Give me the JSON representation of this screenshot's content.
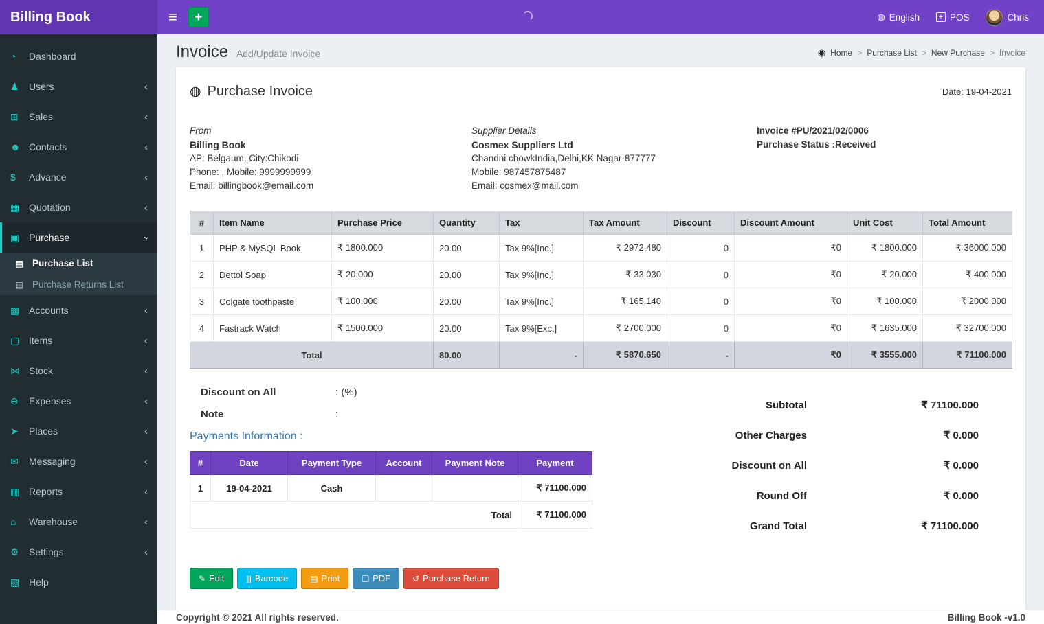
{
  "colors": {
    "navbar_purple": "#7142c8",
    "brand_purple": "#6236b2",
    "sidebar_dark": "#222d32",
    "sidebar_icon_teal": "#26c6c0",
    "table_header_gray": "#d7dbe0",
    "total_row_gray": "#d2d6de",
    "payments_header_purple": "#6e42c1",
    "link_blue": "#337ab7",
    "green": "#00a65a",
    "cyan": "#00c0ef",
    "orange": "#f39c12",
    "blue": "#3c8dbc",
    "red": "#dd4b39"
  },
  "navbar": {
    "brand": "Billing Book",
    "hamburger_glyph": "≡",
    "add_glyph": "+",
    "language": "English",
    "language_glyph": "◍",
    "pos_label": "POS",
    "pos_glyph": "+",
    "user_name": "Chris"
  },
  "sidebar": {
    "items": [
      {
        "label": "Dashboard",
        "icon": "dashboard-icon",
        "glyph": "◔"
      },
      {
        "label": "Users",
        "icon": "user-plus-icon",
        "glyph": "♟",
        "chevron": "collapsed"
      },
      {
        "label": "Sales",
        "icon": "cart-icon",
        "glyph": "⊞",
        "chevron": "collapsed"
      },
      {
        "label": "Contacts",
        "icon": "contacts-icon",
        "glyph": "☻",
        "chevron": "collapsed"
      },
      {
        "label": "Advance",
        "icon": "dollar-icon",
        "glyph": "$",
        "chevron": "collapsed"
      },
      {
        "label": "Quotation",
        "icon": "calendar-icon",
        "glyph": "▦",
        "chevron": "collapsed"
      },
      {
        "label": "Purchase",
        "icon": "basket-icon",
        "glyph": "▣",
        "chevron": "expanded",
        "active": true
      },
      {
        "label": "Purchase List",
        "icon": "list-icon",
        "glyph": "▤",
        "submenu": true,
        "selected": true
      },
      {
        "label": "Purchase Returns List",
        "icon": "list-icon",
        "glyph": "▤",
        "submenu": true,
        "muted": true
      },
      {
        "label": "Accounts",
        "icon": "grid-icon",
        "glyph": "▩",
        "chevron": "collapsed"
      },
      {
        "label": "Items",
        "icon": "items-icon",
        "glyph": "▢",
        "chevron": "collapsed"
      },
      {
        "label": "Stock",
        "icon": "hourglass-icon",
        "glyph": "⋈",
        "chevron": "collapsed"
      },
      {
        "label": "Expenses",
        "icon": "minus-circle-icon",
        "glyph": "⊖",
        "chevron": "collapsed"
      },
      {
        "label": "Places",
        "icon": "paper-plane-icon",
        "glyph": "➤",
        "chevron": "collapsed"
      },
      {
        "label": "Messaging",
        "icon": "envelope-icon",
        "glyph": "✉",
        "chevron": "collapsed"
      },
      {
        "label": "Reports",
        "icon": "bar-chart-icon",
        "glyph": "▥",
        "chevron": "collapsed"
      },
      {
        "label": "Warehouse",
        "icon": "warehouse-icon",
        "glyph": "⌂",
        "chevron": "collapsed"
      },
      {
        "label": "Settings",
        "icon": "gear-icon",
        "glyph": "⚙",
        "chevron": "collapsed"
      },
      {
        "label": "Help",
        "icon": "help-icon",
        "glyph": "▧"
      }
    ]
  },
  "page": {
    "title": "Invoice",
    "subtitle": "Add/Update Invoice",
    "home_glyph": "◉",
    "breadcrumb": [
      "Home",
      "Purchase List",
      "New Purchase",
      "Invoice"
    ]
  },
  "invoice": {
    "heading": "Purchase Invoice",
    "heading_glyph": "◍",
    "date_label": "Date: 19-04-2021",
    "from": {
      "title": "From",
      "name": "Billing Book",
      "address": "AP: Belgaum, City:Chikodi",
      "phone": "Phone: , Mobile: 9999999999",
      "email": "Email: billingbook@email.com"
    },
    "supplier": {
      "title": "Supplier Details",
      "name": "Cosmex Suppliers Ltd",
      "address": "Chandni chowkIndia,Delhi,KK Nagar-877777",
      "mobile": "Mobile: 987457875487",
      "email": "Email: cosmex@mail.com"
    },
    "meta": {
      "invoice_no": "Invoice #PU/2021/02/0006",
      "status": "Purchase Status :Received"
    }
  },
  "items_table": {
    "headers": [
      "#",
      "Item Name",
      "Purchase Price",
      "Quantity",
      "Tax",
      "Tax Amount",
      "Discount",
      "Discount Amount",
      "Unit Cost",
      "Total Amount"
    ],
    "rows": [
      [
        "1",
        "PHP & MySQL Book",
        "₹ 1800.000",
        "20.00",
        "Tax 9%[Inc.]",
        "₹ 2972.480",
        "0",
        "₹0",
        "₹ 1800.000",
        "₹ 36000.000"
      ],
      [
        "2",
        "Dettol Soap",
        "₹ 20.000",
        "20.00",
        "Tax 9%[Inc.]",
        "₹ 33.030",
        "0",
        "₹0",
        "₹ 20.000",
        "₹ 400.000"
      ],
      [
        "3",
        "Colgate toothpaste",
        "₹ 100.000",
        "20.00",
        "Tax 9%[Inc.]",
        "₹ 165.140",
        "0",
        "₹0",
        "₹ 100.000",
        "₹ 2000.000"
      ],
      [
        "4",
        "Fastrack Watch",
        "₹ 1500.000",
        "20.00",
        "Tax 9%[Exc.]",
        "₹ 2700.000",
        "0",
        "₹0",
        "₹ 1635.000",
        "₹ 32700.000"
      ]
    ],
    "total_row": [
      "Total",
      "80.00",
      "-",
      "₹ 5870.650",
      "-",
      "₹0",
      "₹ 3555.000",
      "₹ 71100.000"
    ]
  },
  "extras": {
    "discount_label": "Discount on All",
    "discount_value": ": (%)",
    "note_label": "Note",
    "note_value": ":"
  },
  "payments": {
    "title": "Payments Information :",
    "headers": [
      "#",
      "Date",
      "Payment Type",
      "Account",
      "Payment Note",
      "Payment"
    ],
    "rows": [
      [
        "1",
        "19-04-2021",
        "Cash",
        "",
        "",
        "₹ 71100.000"
      ]
    ],
    "total_label": "Total",
    "total_value": "₹ 71100.000"
  },
  "summary": {
    "rows": [
      {
        "label": "Subtotal",
        "value": "₹ 71100.000"
      },
      {
        "label": "Other Charges",
        "value": "₹ 0.000"
      },
      {
        "label": "Discount on All",
        "value": "₹ 0.000"
      },
      {
        "label": "Round Off",
        "value": "₹ 0.000"
      },
      {
        "label": "Grand Total",
        "value": "₹ 71100.000"
      }
    ]
  },
  "actions": [
    {
      "name": "edit-button",
      "icon": "edit-icon",
      "label": "Edit",
      "glyph": "✎",
      "color": "#00a65a"
    },
    {
      "name": "barcode-button",
      "icon": "barcode-icon",
      "label": "Barcode",
      "glyph": "|||",
      "color": "#00c0ef"
    },
    {
      "name": "print-button",
      "icon": "print-icon",
      "label": "Print",
      "glyph": "▤",
      "color": "#f39c12"
    },
    {
      "name": "pdf-button",
      "icon": "pdf-icon",
      "label": "PDF",
      "glyph": "❏",
      "color": "#3c8dbc"
    },
    {
      "name": "purchase-return-button",
      "icon": "undo-icon",
      "label": "Purchase Return",
      "glyph": "↺",
      "color": "#dd4b39"
    }
  ],
  "footer": {
    "copyright": "Copyright © 2021 All rights reserved.",
    "version": "Billing Book -v1.0"
  }
}
